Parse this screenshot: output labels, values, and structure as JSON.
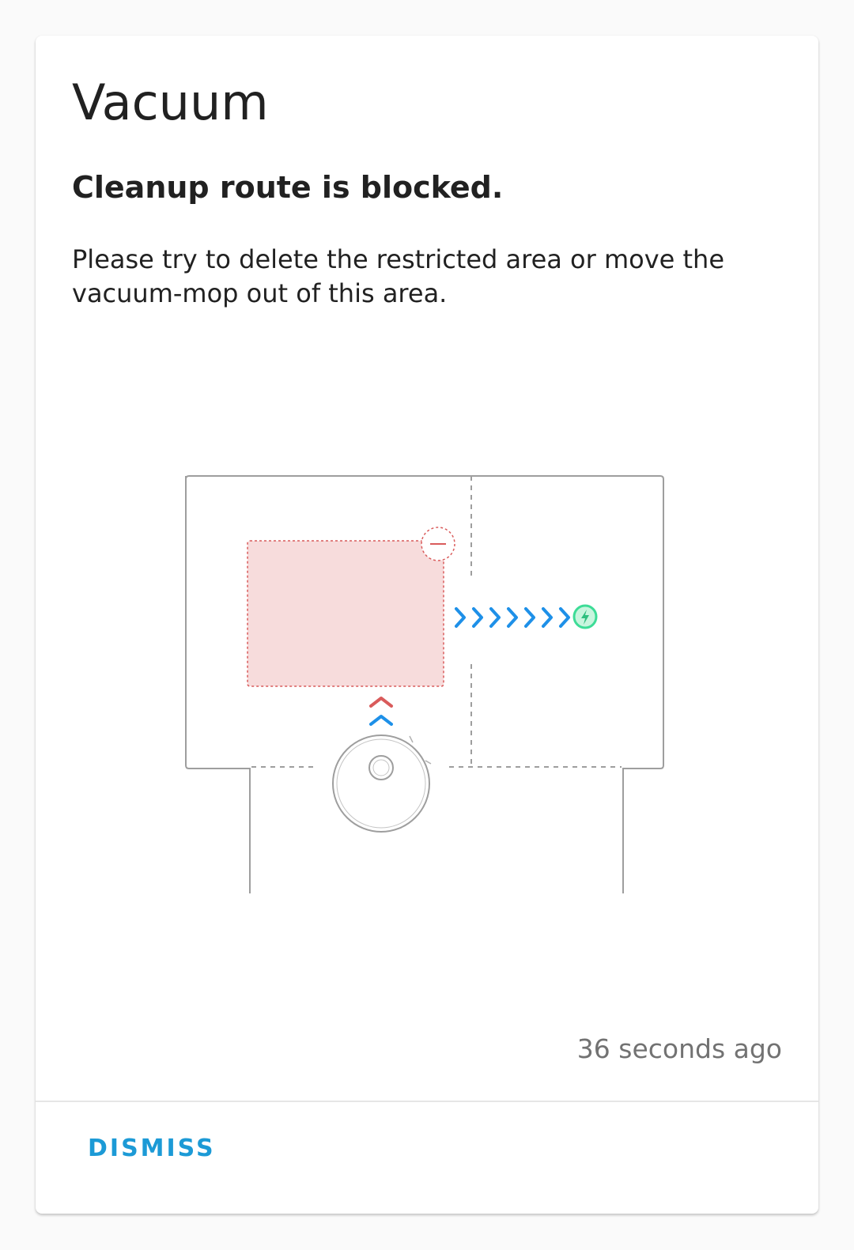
{
  "card": {
    "title": "Vacuum",
    "headline": "Cleanup route is blocked.",
    "message": "Please try to delete the restricted area or move the vacuum-mop out of this area.",
    "timestamp": "36 seconds ago",
    "dismiss_label": "DISMISS"
  },
  "illustration": {
    "restricted_zone_color": "#f7dcdc",
    "restricted_border_color": "#d95b5b",
    "route_arrow_color": "#1e90e8",
    "charger_color": "#3ddc97",
    "icons": [
      "remove-zone-icon",
      "chevron-right-icon",
      "charging-dock-icon",
      "chevron-up-icon",
      "robot-vacuum-icon"
    ]
  },
  "colors": {
    "accent": "#1c9ad6",
    "background": "#fafafa",
    "card": "#ffffff",
    "text_primary": "#212121",
    "text_secondary": "#727272"
  }
}
